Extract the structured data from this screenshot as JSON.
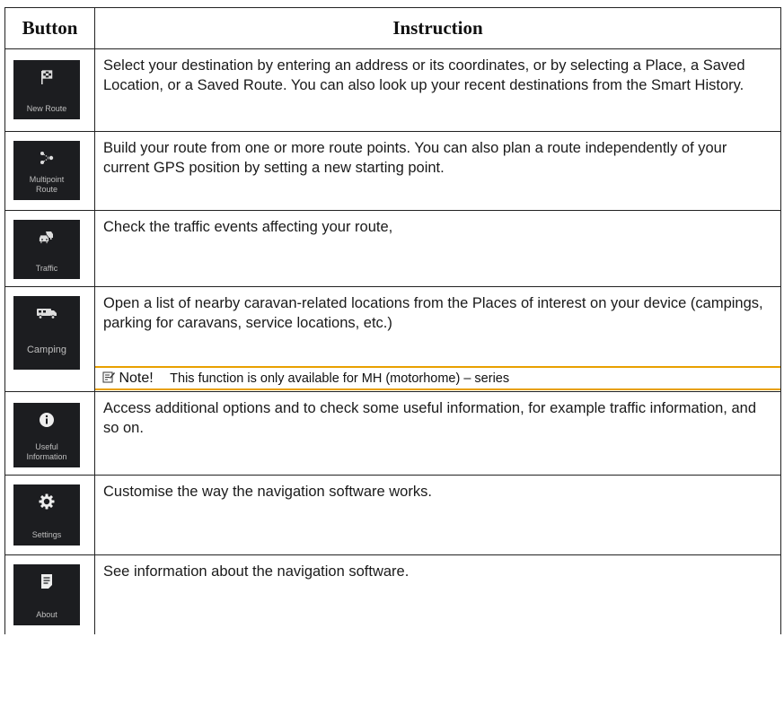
{
  "table": {
    "header_button": "Button",
    "header_instruction": "Instruction"
  },
  "rows": [
    {
      "icon": "checkered-flag-icon",
      "button_label": "New Route",
      "instruction": "Select your destination by entering an address or its coordinates, or by selecting a Place, a Saved Location, or a Saved Route. You can also look up your recent destinations from the Smart History."
    },
    {
      "icon": "route-points-icon",
      "button_label_line1": "Multipoint",
      "button_label_line2": "Route",
      "instruction": "Build your route from one or more route points. You can also plan a route independently of your current GPS position by setting a new starting point."
    },
    {
      "icon": "traffic-cars-icon",
      "button_label": "Traffic",
      "instruction": "Check the traffic events affecting your route,"
    },
    {
      "icon": "camper-van-icon",
      "button_label": "Camping",
      "instruction": "Open a list of nearby caravan-related locations from the Places of interest on your device (campings, parking for caravans, service locations, etc.)",
      "note_keyword": "Note!",
      "note_text": "This function is only available for MH (motorhome) – series"
    },
    {
      "icon": "info-icon",
      "button_label_line1": "Useful",
      "button_label_line2": "Information",
      "instruction": "Access additional options and to check some useful information, for example traffic information, and so on."
    },
    {
      "icon": "gear-icon",
      "button_label": "Settings",
      "instruction": "Customise the way the navigation software works."
    },
    {
      "icon": "document-icon",
      "button_label": "About",
      "instruction": "See information about the navigation software."
    }
  ],
  "colors": {
    "tile_bg": "#1c1d20",
    "note_border": "#e8a000"
  }
}
